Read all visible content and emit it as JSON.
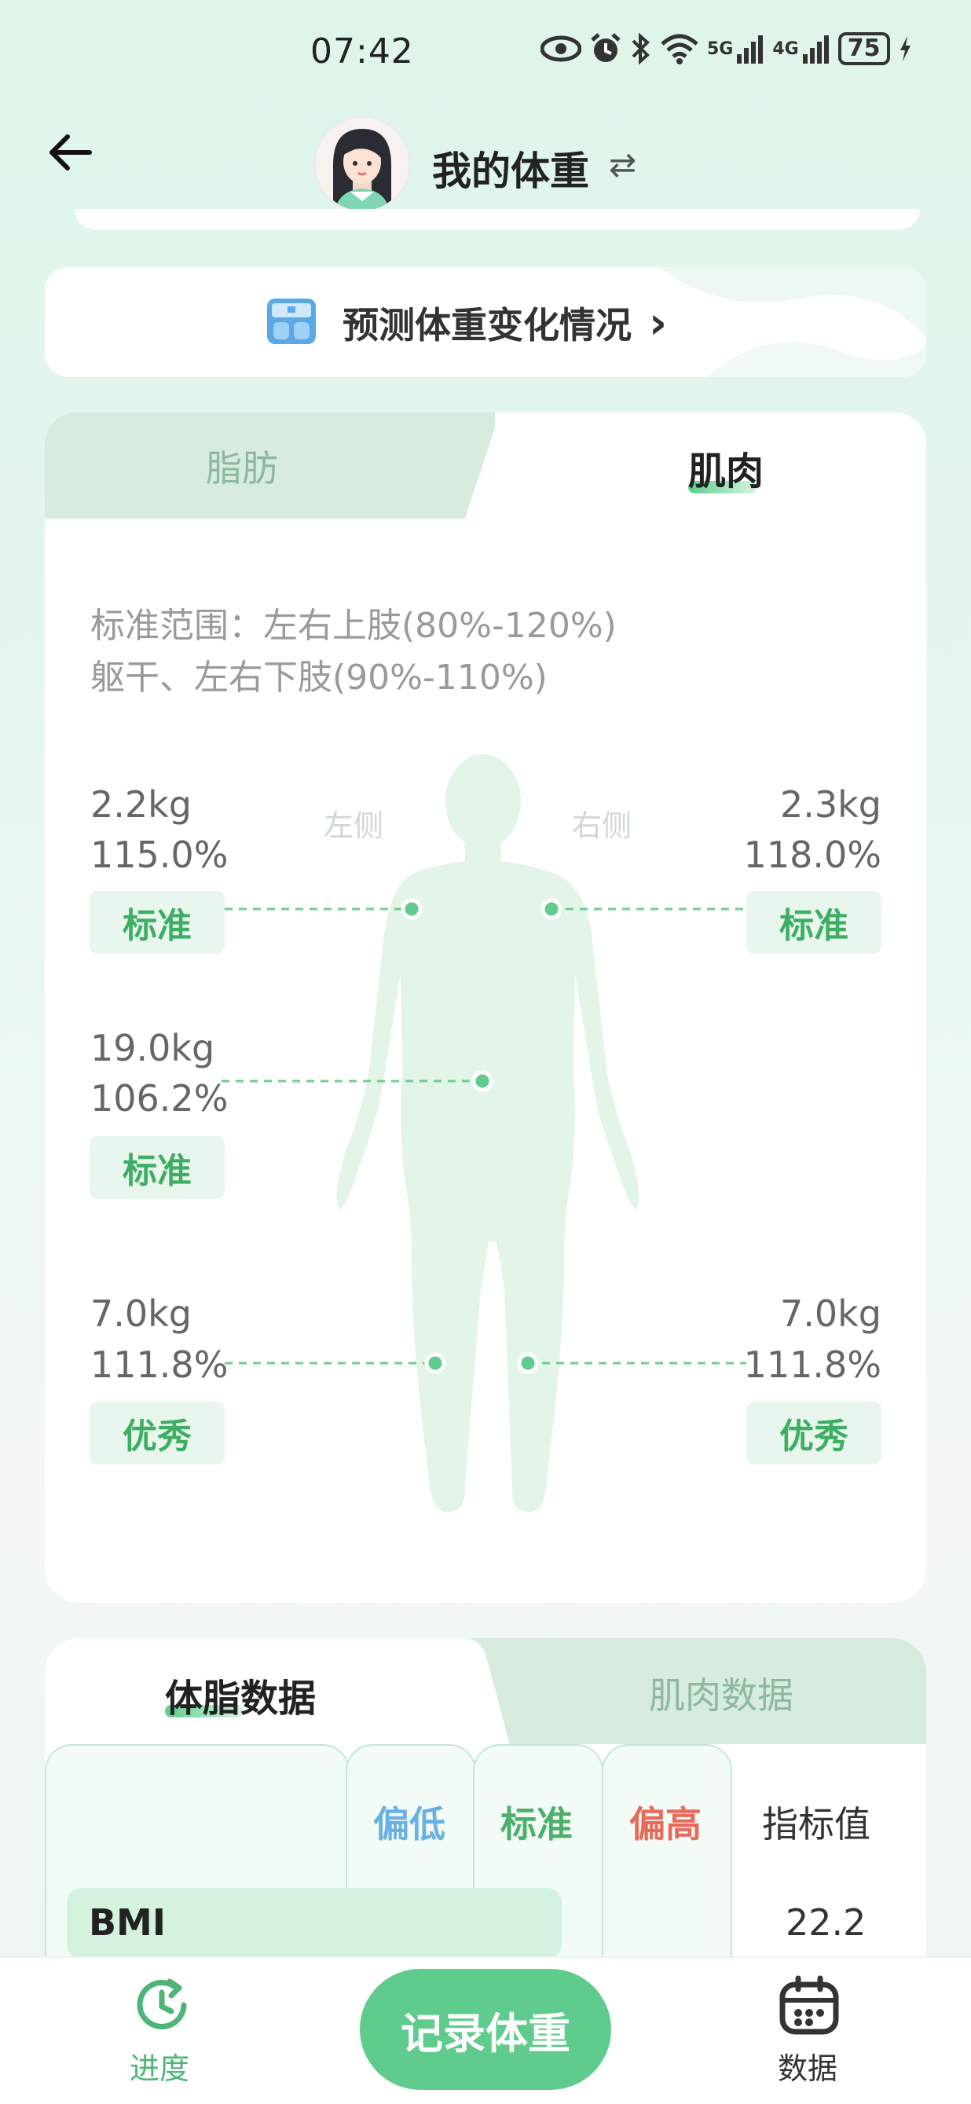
{
  "status_bar": {
    "time": "07:42",
    "battery": "75",
    "network_a": "5G",
    "network_b": "4G"
  },
  "header": {
    "title": "我的体重",
    "swap_icon": "⇄"
  },
  "predict": {
    "label": "预测体重变化情况",
    "chevron": "›"
  },
  "composition": {
    "tabs": [
      {
        "label": "脂肪"
      },
      {
        "label": "肌肉"
      }
    ],
    "active_tab": "肌肉",
    "standard_line1": "标准范围：左右上肢(80%-120%)",
    "standard_line2": "躯干、左右下肢(90%-110%)",
    "side_left": "左侧",
    "side_right": "右侧",
    "segments": {
      "left_arm": {
        "kg": "2.2kg",
        "pct": "115.0%",
        "status": "标准"
      },
      "right_arm": {
        "kg": "2.3kg",
        "pct": "118.0%",
        "status": "标准"
      },
      "trunk": {
        "kg": "19.0kg",
        "pct": "106.2%",
        "status": "标准"
      },
      "left_leg": {
        "kg": "7.0kg",
        "pct": "111.8%",
        "status": "优秀"
      },
      "right_leg": {
        "kg": "7.0kg",
        "pct": "111.8%",
        "status": "优秀"
      }
    }
  },
  "data_tabs": {
    "fat": "体脂数据",
    "muscle": "肌肉数据"
  },
  "table": {
    "headers": {
      "low": "偏低",
      "standard": "标准",
      "high": "偏高",
      "value": "指标值"
    },
    "rows": [
      {
        "name": "BMI",
        "value": "22.2"
      }
    ]
  },
  "nav": {
    "progress": "进度",
    "record": "记录体重",
    "data": "数据"
  },
  "colors": {
    "accent": "#5fcb8c",
    "low": "#6ab1e3",
    "standard": "#4caf6a",
    "high": "#e86a5a"
  }
}
